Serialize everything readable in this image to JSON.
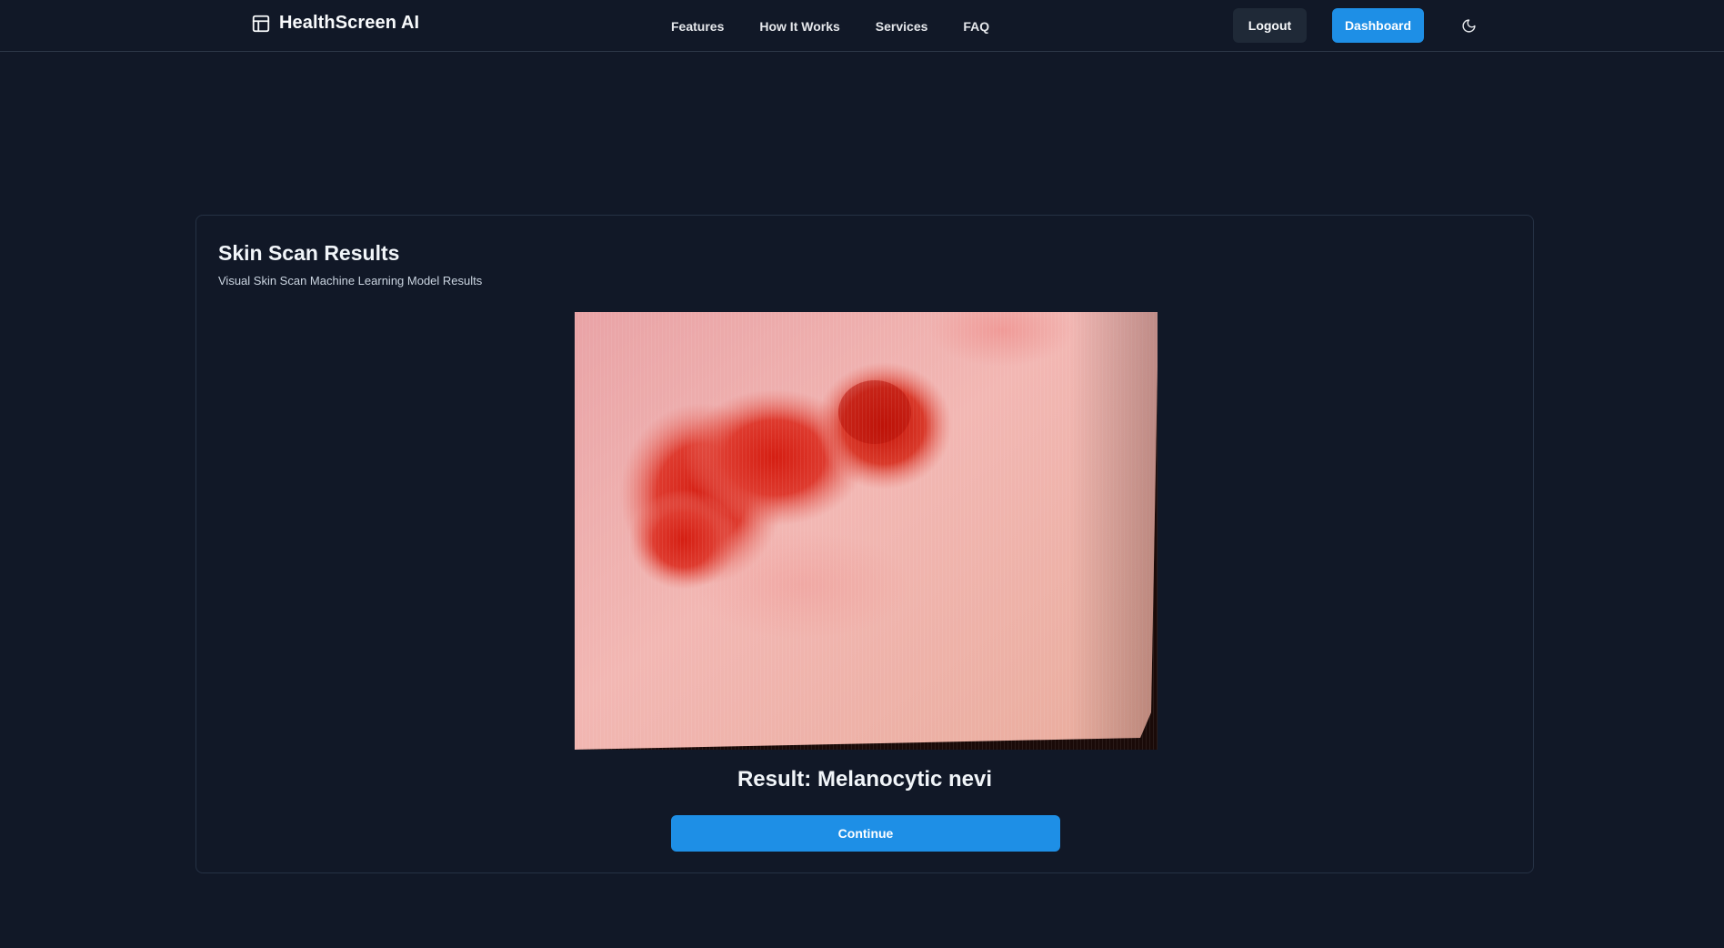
{
  "header": {
    "brand": "HealthScreen AI",
    "brand_icon": "layout-panel-icon",
    "nav": [
      "Features",
      "How It Works",
      "Services",
      "FAQ"
    ],
    "logout_label": "Logout",
    "dashboard_label": "Dashboard",
    "theme_icon": "moon-icon"
  },
  "card": {
    "title": "Skin Scan Results",
    "subtitle": "Visual Skin Scan Machine Learning Model Results",
    "image_alt": "skin lesion scan",
    "result_text": "Result: Melanocytic nevi",
    "continue_label": "Continue"
  },
  "colors": {
    "background": "#111827",
    "accent": "#1e8fe6",
    "secondary_button": "#1f2937"
  }
}
